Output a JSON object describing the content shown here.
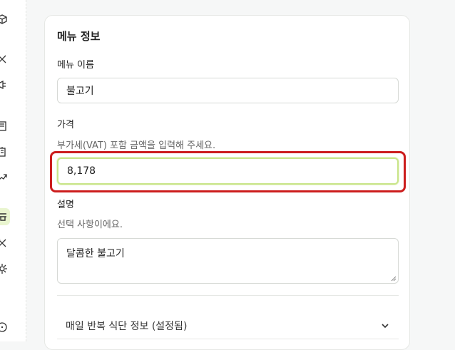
{
  "sidebar": {
    "icons": [
      "box-icon",
      "tools-icon",
      "megaphone-icon",
      "book-icon",
      "building-icon",
      "trend-icon",
      "menu-store-icon",
      "cutlery-icon",
      "gear-icon",
      "help-icon"
    ],
    "active": "menu-store-icon"
  },
  "menu_info": {
    "title": "메뉴 정보",
    "name_label": "메뉴 이름",
    "name_value": "불고기",
    "price_label": "가격",
    "price_hint": "부가세(VAT) 포함 금액을 입력해 주세요.",
    "price_value": "8,178",
    "desc_label": "설명",
    "desc_hint": "선택 사항이에요.",
    "desc_value": "달콤한 불고기",
    "accordion_label": "매일 반복 식단 정보 (설정됨)"
  },
  "colors": {
    "accent": "#c9e58a",
    "highlight": "#cc1d1d"
  }
}
